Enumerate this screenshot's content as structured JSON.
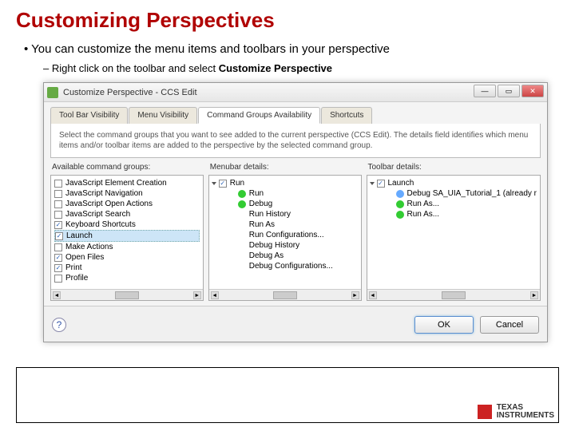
{
  "title": "Customizing Perspectives",
  "b1": "You can customize the menu items and toolbars in your perspective",
  "b2a": "Right click on the toolbar and select ",
  "b2b": "Customize Perspective",
  "dialog": {
    "title": "Customize Perspective - CCS Edit",
    "tabs": [
      "Tool Bar Visibility",
      "Menu Visibility",
      "Command Groups Availability",
      "Shortcuts"
    ],
    "desc": "Select the command groups that you want to see added to the current perspective (CCS Edit). The details field identifies which menu items and/or toolbar items are added to the perspective by the selected command group.",
    "headers": {
      "a": "Available command groups:",
      "b": "Menubar details:",
      "c": "Toolbar details:"
    },
    "available": [
      {
        "chk": false,
        "label": "JavaScript Element Creation"
      },
      {
        "chk": false,
        "label": "JavaScript Navigation"
      },
      {
        "chk": false,
        "label": "JavaScript Open Actions"
      },
      {
        "chk": false,
        "label": "JavaScript Search"
      },
      {
        "chk": true,
        "label": "Keyboard Shortcuts"
      },
      {
        "chk": true,
        "label": "Launch",
        "selected": true
      },
      {
        "chk": false,
        "label": "Make Actions"
      },
      {
        "chk": true,
        "label": "Open Files"
      },
      {
        "chk": true,
        "label": "Print"
      },
      {
        "chk": false,
        "label": "Profile"
      }
    ],
    "menubar": {
      "root": "Run",
      "items": [
        "Run",
        "Debug",
        "Run History",
        "Run As",
        "Run Configurations...",
        "Debug History",
        "Debug As",
        "Debug Configurations..."
      ]
    },
    "toolbar": {
      "root": "Launch",
      "items": [
        "Debug SA_UIA_Tutorial_1 (already r",
        "Run As...",
        "Run As..."
      ]
    },
    "ok": "OK",
    "cancel": "Cancel"
  },
  "brand": {
    "line1": "TEXAS",
    "line2": "INSTRUMENTS"
  }
}
